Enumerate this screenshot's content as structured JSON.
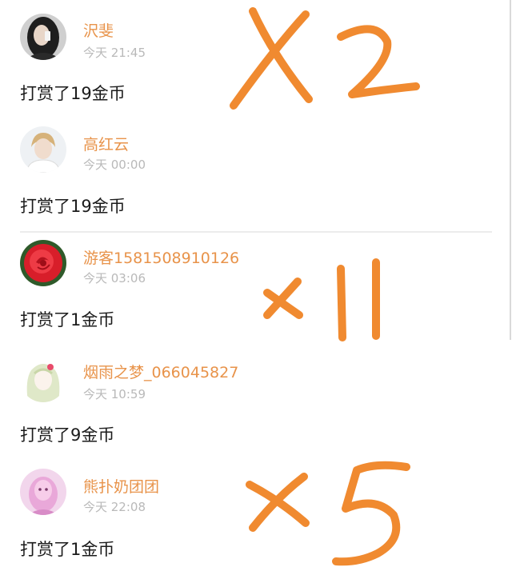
{
  "reward_feed": {
    "entries": [
      {
        "name": "沢斐",
        "time": "今天 21:45",
        "message": "打赏了19金币",
        "avatar_icon": "girl-dark-hair-avatar-icon"
      },
      {
        "name": "高红云",
        "time": "今天 00:00",
        "message": "打赏了19金币",
        "avatar_icon": "boy-white-shirt-avatar-icon"
      },
      {
        "name": "游客1581508910126",
        "time": "今天 03:06",
        "message": "打赏了1金币",
        "avatar_icon": "red-rose-avatar-icon"
      },
      {
        "name": "烟雨之梦_066045827",
        "time": "今天 10:59",
        "message": "打赏了9金币",
        "avatar_icon": "anime-girl-avatar-icon"
      },
      {
        "name": "熊扑奶团团",
        "time": "今天 22:08",
        "message": "打赏了1金币",
        "avatar_icon": "pink-portrait-avatar-icon"
      }
    ]
  },
  "handwritten_annotations": [
    {
      "text": "X2",
      "color": "#f08a30"
    },
    {
      "text": "×11",
      "color": "#f08a30"
    },
    {
      "text": "×5",
      "color": "#f08a30"
    }
  ],
  "colors": {
    "username": "#e8934a",
    "timestamp": "#b9b9b9",
    "message": "#1b1b1b",
    "annotation": "#f08a30"
  }
}
